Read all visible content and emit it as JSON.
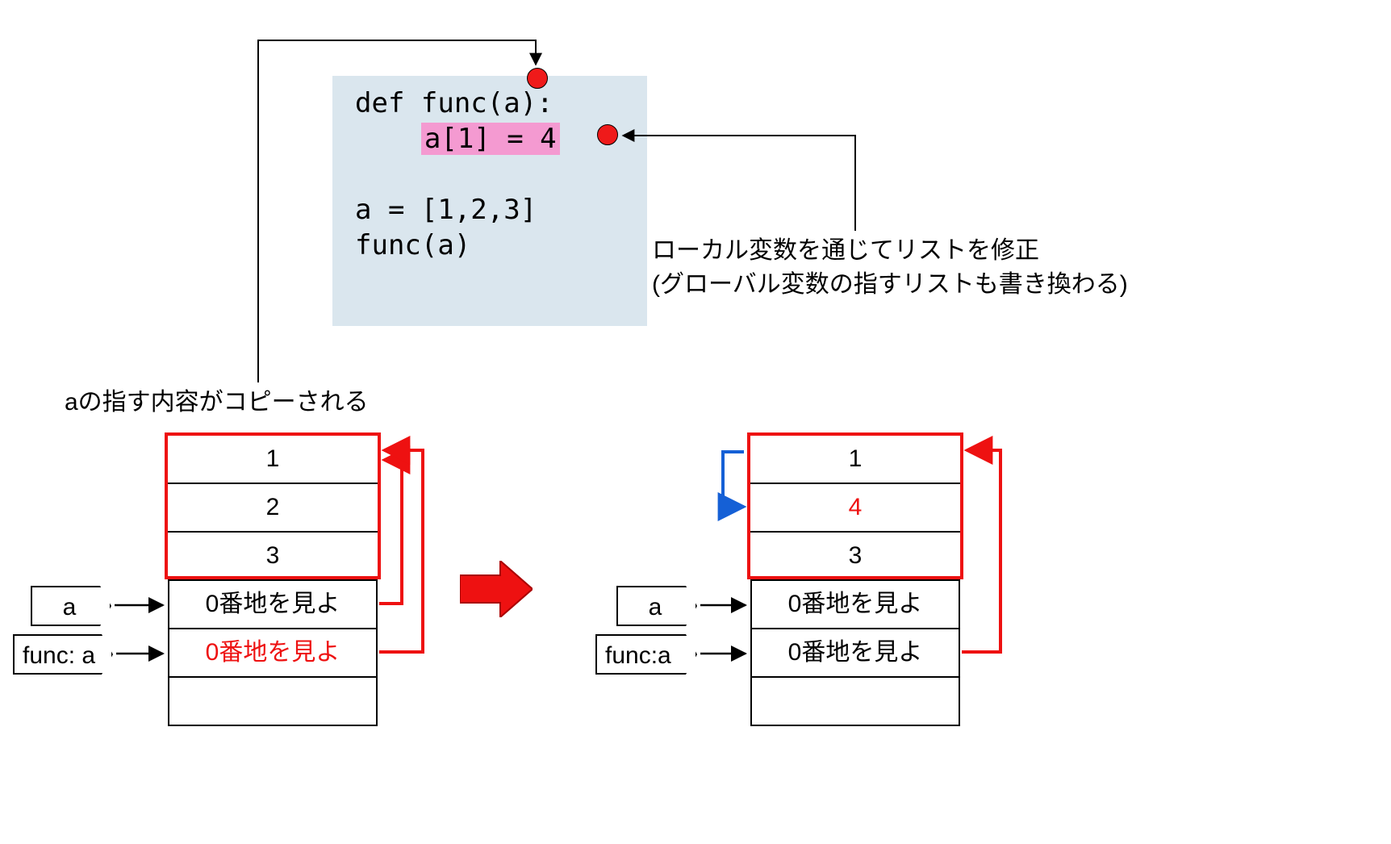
{
  "code": {
    "line1": "def func(a):",
    "line2_hl": "a[1] = 4",
    "line4": "a = [1,2,3]",
    "line5": "func(a)"
  },
  "markers": {
    "dot1": "param-marker",
    "dot2": "mutation-marker"
  },
  "captions": {
    "left": "aの指す内容がコピーされる",
    "right": "ローカル変数を通じてリストを修正\n(グローバル変数の指すリストも書き換わる)"
  },
  "left_state": {
    "list": [
      "1",
      "2",
      "3"
    ],
    "slots": [
      "0番地を見よ",
      "0番地を見よ",
      ""
    ],
    "slot2_red": true,
    "var_labels": [
      "a",
      "func: a"
    ]
  },
  "right_state": {
    "list": [
      "1",
      "4",
      "3"
    ],
    "list_changed_index": 1,
    "slots": [
      "0番地を見よ",
      "0番地を見よ",
      ""
    ],
    "var_labels": [
      "a",
      "func:a"
    ]
  }
}
